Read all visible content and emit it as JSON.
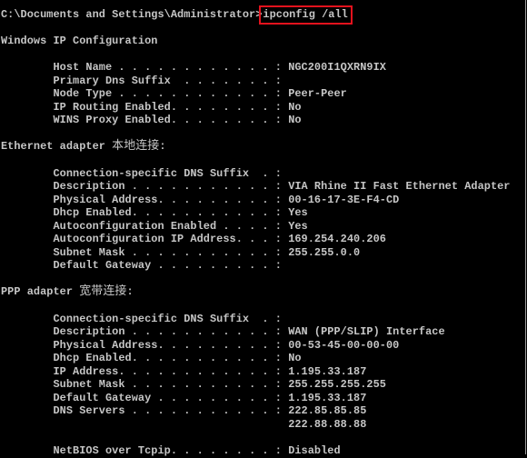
{
  "prompt": {
    "path": "C:\\Documents and Settings\\Administrator>",
    "command": "ipconfig /all",
    "highlight_color": "#e3121d"
  },
  "windows_ip": {
    "heading": "Windows IP Configuration",
    "rows": [
      {
        "label": "Host Name . . . . . . . . . . . . : ",
        "value": "NGC200I1QXRN9IX"
      },
      {
        "label": "Primary Dns Suffix  . . . . . . . : ",
        "value": ""
      },
      {
        "label": "Node Type . . . . . . . . . . . . : ",
        "value": "Peer-Peer"
      },
      {
        "label": "IP Routing Enabled. . . . . . . . : ",
        "value": "No"
      },
      {
        "label": "WINS Proxy Enabled. . . . . . . . : ",
        "value": "No"
      }
    ]
  },
  "ethernet": {
    "heading_prefix": "Ethernet adapter ",
    "heading_name": "本地连接",
    "heading_suffix": ":",
    "rows": [
      {
        "label": "Connection-specific DNS Suffix  . : ",
        "value": ""
      },
      {
        "label": "Description . . . . . . . . . . . : ",
        "value": "VIA Rhine II Fast Ethernet Adapter"
      },
      {
        "label": "Physical Address. . . . . . . . . : ",
        "value": "00-16-17-3E-F4-CD"
      },
      {
        "label": "Dhcp Enabled. . . . . . . . . . . : ",
        "value": "Yes"
      },
      {
        "label": "Autoconfiguration Enabled . . . . : ",
        "value": "Yes"
      },
      {
        "label": "Autoconfiguration IP Address. . . : ",
        "value": "169.254.240.206"
      },
      {
        "label": "Subnet Mask . . . . . . . . . . . : ",
        "value": "255.255.0.0"
      },
      {
        "label": "Default Gateway . . . . . . . . . : ",
        "value": ""
      }
    ]
  },
  "ppp": {
    "heading_prefix": "PPP adapter ",
    "heading_name": "宽带连接",
    "heading_suffix": ":",
    "rows": [
      {
        "label": "Connection-specific DNS Suffix  . : ",
        "value": ""
      },
      {
        "label": "Description . . . . . . . . . . . : ",
        "value": "WAN (PPP/SLIP) Interface"
      },
      {
        "label": "Physical Address. . . . . . . . . : ",
        "value": "00-53-45-00-00-00"
      },
      {
        "label": "Dhcp Enabled. . . . . . . . . . . : ",
        "value": "No"
      },
      {
        "label": "IP Address. . . . . . . . . . . . : ",
        "value": "1.195.33.187"
      },
      {
        "label": "Subnet Mask . . . . . . . . . . . : ",
        "value": "255.255.255.255"
      },
      {
        "label": "Default Gateway . . . . . . . . . : ",
        "value": "1.195.33.187"
      },
      {
        "label": "DNS Servers . . . . . . . . . . . : ",
        "value": "222.85.85.85"
      },
      {
        "label": "                                    ",
        "value": "222.88.88.88"
      },
      {
        "label": "NetBIOS over Tcpip. . . . . . . . : ",
        "value": "Disabled"
      }
    ]
  }
}
